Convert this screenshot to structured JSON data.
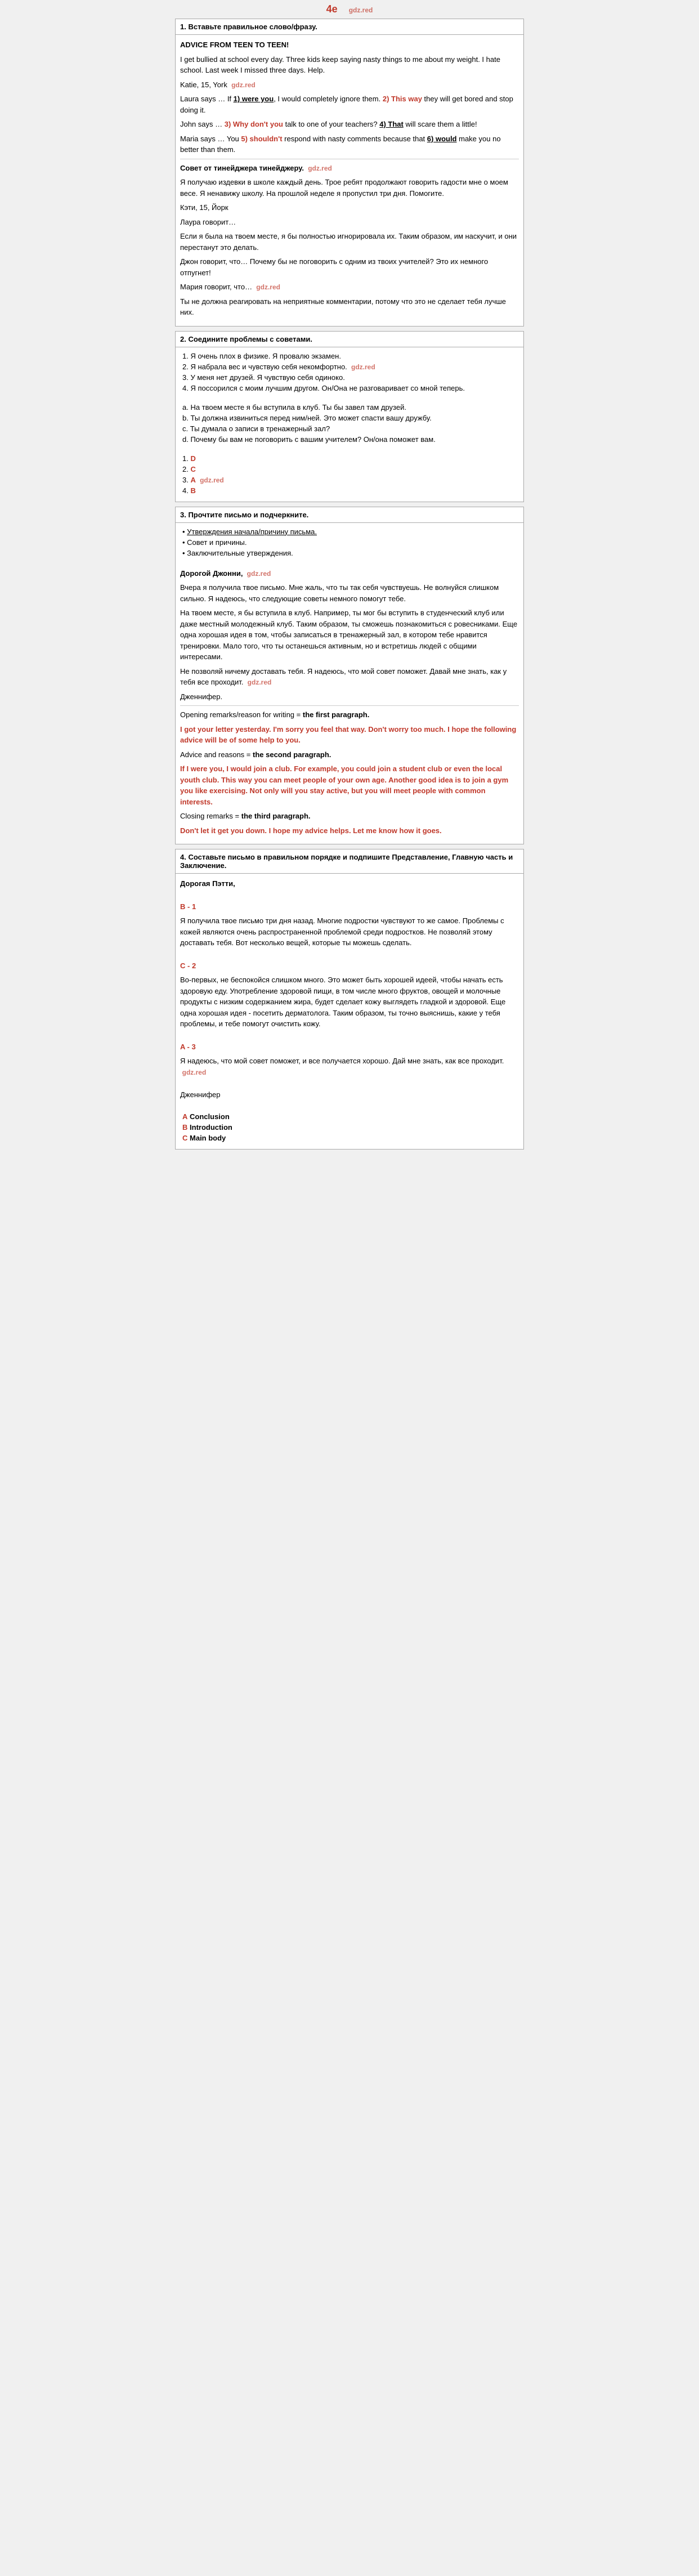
{
  "header": {
    "label": "4e",
    "watermark": "gdz.red"
  },
  "sections": [
    {
      "id": "section1",
      "title": "1. Вставьте правильное слово/фразу.",
      "content": {
        "advice_title": "ADVICE FROM TEEN TO TEEN!",
        "paragraphs": [
          "I get bullied at school every day. Three kids keep saying nasty things to me about my weight. I hate school. Last week I missed three days. Help.",
          "Katie, 15, York",
          "Laura says … If 1) were you, I would completely ignore them. 2) This way they will get bored and stop doing it.",
          "John says … 3) Why don't you talk to one of your teachers? 4) That will scare them a little!",
          "Maria says … You 5) shouldn't respond with nasty comments because that 6) would make you no better than them."
        ],
        "ru_title": "Совет от тинейджера тинейджеру.",
        "ru_paragraphs": [
          "Я получаю издевки в школе каждый день. Трое ребят продолжают говорить гадости мне о моем весе. Я ненавижу школу. На прошлой неделе я пропустил три дня. Помогите.",
          "Кэти, 15, Йорк",
          "Лаура говорит…",
          "Если я была на твоем месте, я бы полностью игнорировала их. Таким образом, им наскучит, и они перестанут это делать.",
          "Джон говорит, что… Почему бы не поговорить с одним из твоих учителей? Это их немного отпугнет!",
          "Мария говорит, что…",
          "Ты не должна реагировать на неприятные комментарии, потому что это не сделает тебя лучше них."
        ]
      }
    },
    {
      "id": "section2",
      "title": "2. Соедините проблемы с советами.",
      "problems": [
        "1. Я очень плох в физике. Я провалю экзамен.",
        "2. Я набрала вес и чувствую себя некомфортно.",
        "3. У меня нет друзей. Я чувствую себя одиноко.",
        "4. Я поссорился с моим лучшим другом. Он/Она не разговаривает со мной теперь."
      ],
      "advices": [
        "a. На твоем месте я бы вступила в клуб. Ты бы завел там друзей.",
        "b. Ты должна извиниться перед ним/ней. Это может спасти вашу дружбу.",
        "c. Ты думала о записи в тренажерный зал?",
        "d. Почему бы нам не поговорить с вашим учителем? Он/она поможет вам."
      ],
      "answers": [
        {
          "num": "1.",
          "letter": "D"
        },
        {
          "num": "2.",
          "letter": "C"
        },
        {
          "num": "3.",
          "letter": "A"
        },
        {
          "num": "4.",
          "letter": "B"
        }
      ]
    },
    {
      "id": "section3",
      "title": "3. Прочтите письмо и подчеркните.",
      "bullets": [
        "• Утверждения начала/причину письма.",
        "• Совет и причины.",
        "• Заключительные утверждения."
      ],
      "letter": {
        "greeting": "Дорогой Джонни,",
        "body_ru": [
          "Вчера я получила твое письмо. Мне жаль, что ты так себя чувствуешь. Не волнуйся слишком сильно. Я надеюсь, что следующие советы немного помогут тебе.",
          "На твоем месте, я бы вступила в клуб. Например, ты мог бы вступить в студенческий клуб или даже местный молодежный клуб. Таким образом, ты сможешь познакомиться с ровесниками. Еще одна хорошая идея в том, чтобы записаться в тренажерный зал, в котором тебе нравится тренировки. Мало того, что ты останешься активным, но и встретишь людей с общими интересами.",
          "Не позволяй ничему доставать тебя. Я надеюсь, что мой совет поможет. Давай мне знать, как у тебя все проходит.",
          "Дженнифер."
        ],
        "analysis": [
          {
            "label": "Opening remarks/reason for writing = the first paragraph.",
            "en": "I got your letter yesterday. I'm sorry you feel that way. Don't worry too much. I hope the following advice will be of some help to you."
          },
          {
            "label": "Advice and reasons = the second paragraph.",
            "en": "If I were you, I would join a club. For example, you could join a student club or even the local youth club. This way you can meet people of your own age. Another good idea is to join a gym you like exercising. Not only will you stay active, but you will meet people with common interests."
          },
          {
            "label": "Closing remarks = the third paragraph.",
            "en": "Don't let it get you down. I hope my advice helps. Let me know how it goes."
          }
        ]
      }
    },
    {
      "id": "section4",
      "title": "4. Составьте письмо в правильном порядке и подпишите Представление, Главную часть и Заключение.",
      "letter2": {
        "greeting": "Дорогая Пэтти,",
        "part_b": "B - 1",
        "part_b_text": "Я получила твое письмо три дня назад. Многие подростки чувствуют то же самое. Проблемы с кожей являются очень распространенной проблемой среди подростков. Не позволяй этому доставать тебя. Вот несколько вещей, которые ты можешь сделать.",
        "part_c": "С - 2",
        "part_c_text": "Во-первых, не беспокойся слишком много. Это может быть хорошей идеей, чтобы начать есть здоровую еду. Употребление здоровой пищи, в том числе много фруктов, овощей и молочные продукты с низким содержанием жира, будет сделает кожу выглядеть гладкой и здоровой. Еще одна хорошая идея - посетить дерматолога. Таким образом, ты точно выяснишь, какие у тебя проблемы, и тебе помогут очистить кожу.",
        "part_a": "A - 3",
        "part_a_text": "Я надеюсь, что мой совет поможет, и все получается хорошо. Дай мне знать, как все проходит.",
        "sign": "Дженнифер",
        "labels": [
          {
            "letter": "A",
            "label": "Conclusion"
          },
          {
            "letter": "B",
            "label": "Introduction"
          },
          {
            "letter": "C",
            "label": "Main body"
          }
        ]
      }
    }
  ]
}
